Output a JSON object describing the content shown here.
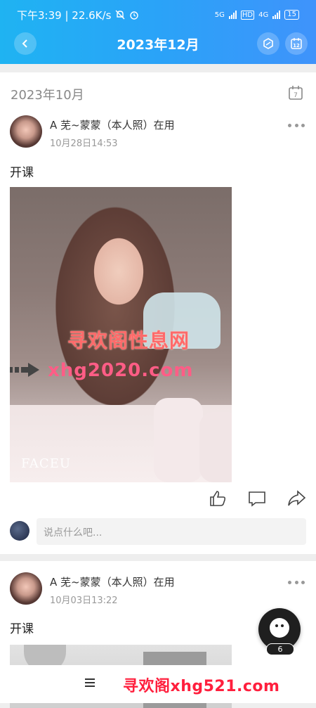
{
  "status": {
    "time_speed": "下午3:39 | 22.6K/s",
    "net1": "5G",
    "net2": "HD",
    "net3": "4G",
    "battery": "15"
  },
  "header": {
    "title": "2023年12月",
    "back_icon": "back-arrow-icon",
    "hex_icon": "hexagon-icon",
    "calendar_day": "12"
  },
  "month_section": {
    "label": "2023年10月",
    "calendar_day": "7"
  },
  "posts": [
    {
      "author": "A 芜~蒙蒙（本人照）在用",
      "time": "10月28日14:53",
      "text": "开课",
      "watermark_cn": "寻欢阁性息网",
      "watermark_url": "xhg2020.com",
      "photo_brand": "FACEU"
    },
    {
      "author": "A 芜~蒙蒙（本人照）在用",
      "time": "10月03日13:22",
      "text": "开课"
    }
  ],
  "actions": {
    "like_icon": "thumbs-up-icon",
    "comment_icon": "comment-icon",
    "share_icon": "share-icon"
  },
  "comment": {
    "placeholder": "说点什么吧..."
  },
  "fab": {
    "count": "6"
  },
  "bottom": {
    "watermark": "寻欢阁xhg521.com"
  },
  "colors": {
    "header_start": "#1fb3f2",
    "header_end": "#3f93fb",
    "watermark_red": "#ff1f3d"
  }
}
